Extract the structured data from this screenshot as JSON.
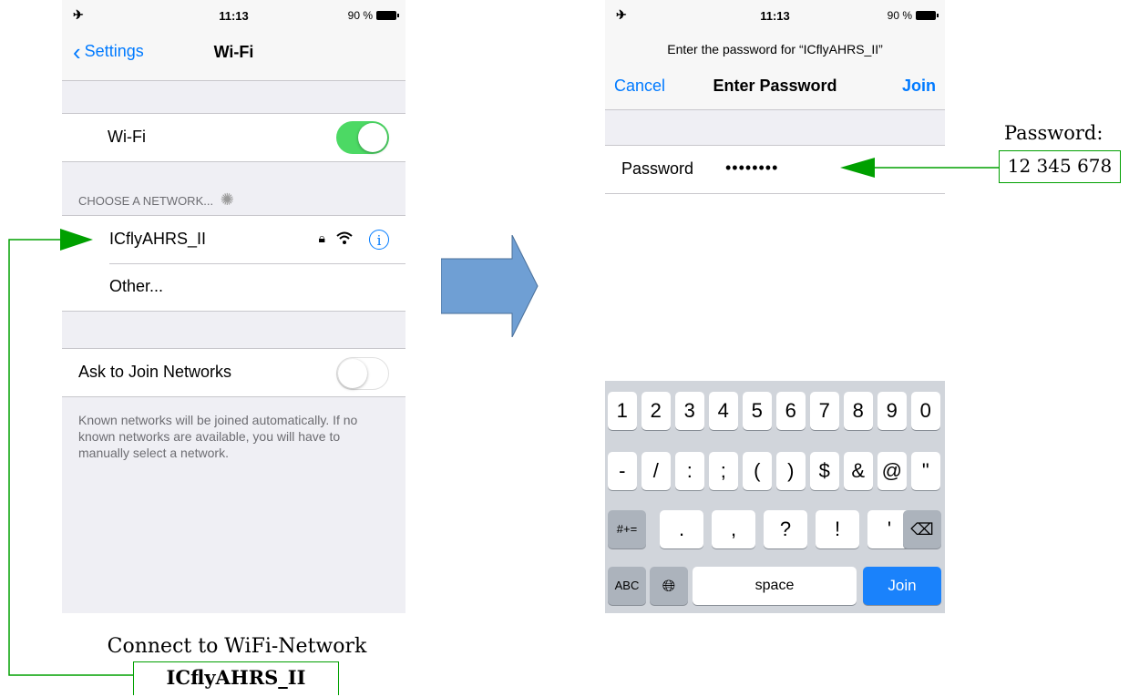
{
  "status_bar": {
    "time": "11:13",
    "battery": "90 %",
    "airplane": "airplane-icon"
  },
  "wifi_screen": {
    "back_label": "Settings",
    "title": "Wi-Fi",
    "wifi_row_label": "Wi-Fi",
    "wifi_toggle_on": true,
    "section_header": "CHOOSE A NETWORK...",
    "networks": [
      {
        "name": "ICflyAHRS_II",
        "secured": true,
        "info": "i"
      },
      {
        "name": "Other..."
      }
    ],
    "ask_to_join_label": "Ask to Join Networks",
    "ask_to_join_on": false,
    "footer": "Known networks will be joined automatically. If no known networks are available, you will have to manually select a network."
  },
  "password_screen": {
    "prompt": "Enter the password for “ICflyAHRS_II”",
    "cancel_label": "Cancel",
    "title": "Enter Password",
    "join_label": "Join",
    "password_label": "Password",
    "password_mask": "••••••••",
    "keyboard": {
      "row1": [
        "1",
        "2",
        "3",
        "4",
        "5",
        "6",
        "7",
        "8",
        "9",
        "0"
      ],
      "row2": [
        "-",
        "/",
        ":",
        ";",
        "(",
        ")",
        "$",
        "&",
        "@",
        "\""
      ],
      "row3_left": "#+=",
      "row3": [
        ".",
        ",",
        "?",
        "!",
        "'"
      ],
      "abc": "ABC",
      "space": "space",
      "join": "Join"
    }
  },
  "annotations": {
    "password_caption": "Password:",
    "password_value": "12 345 678",
    "connect_caption": "Connect to WiFi-Network",
    "network_name": "ICflyAHRS_II"
  },
  "colors": {
    "ios_blue": "#007aff",
    "toggle_green": "#4cd964",
    "arrow_green": "#00a000",
    "flow_arrow": "#6f9fd4"
  }
}
